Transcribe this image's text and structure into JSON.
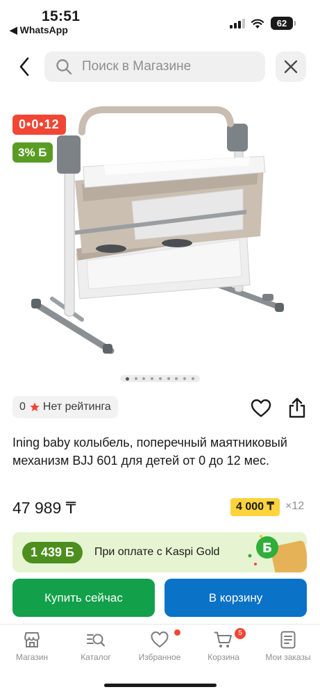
{
  "status_bar": {
    "time": "15:51",
    "back_app": "◀ WhatsApp",
    "battery": "62"
  },
  "header": {
    "search_placeholder": "Поиск в Магазине",
    "back_icon": "chevron-left-icon",
    "close_icon": "close-icon"
  },
  "gallery": {
    "timer_badge": "0•0•12",
    "bonus_badge": "3% Б",
    "pages": 9,
    "active_page": 1
  },
  "product": {
    "rating_value": "0",
    "rating_text": "Нет рейтинга",
    "title": "Ining baby колыбель, поперечный маятниковый механизм BJJ 601 для детей от 0 до 12 мес.",
    "price": "47 989 ₸",
    "installment_amount": "4 000 ₸",
    "installment_months": "×12"
  },
  "kaspi_gold": {
    "bonus": "1 439 Б",
    "text": "При оплате с Kaspi Gold"
  },
  "actions": {
    "buy_now": "Купить сейчас",
    "add_to_cart": "В корзину"
  },
  "tab_bar": {
    "items": [
      {
        "label": "Магазин",
        "icon": "shop-icon"
      },
      {
        "label": "Каталог",
        "icon": "catalog-search-icon"
      },
      {
        "label": "Избранное",
        "icon": "heart-icon"
      },
      {
        "label": "Корзина",
        "icon": "cart-icon"
      },
      {
        "label": "Мои заказы",
        "icon": "orders-icon"
      }
    ],
    "cart_count": "5"
  },
  "colors": {
    "red": "#f14635",
    "green": "#13a04a",
    "blue": "#0a72c7",
    "yellow": "#ffd33d"
  }
}
